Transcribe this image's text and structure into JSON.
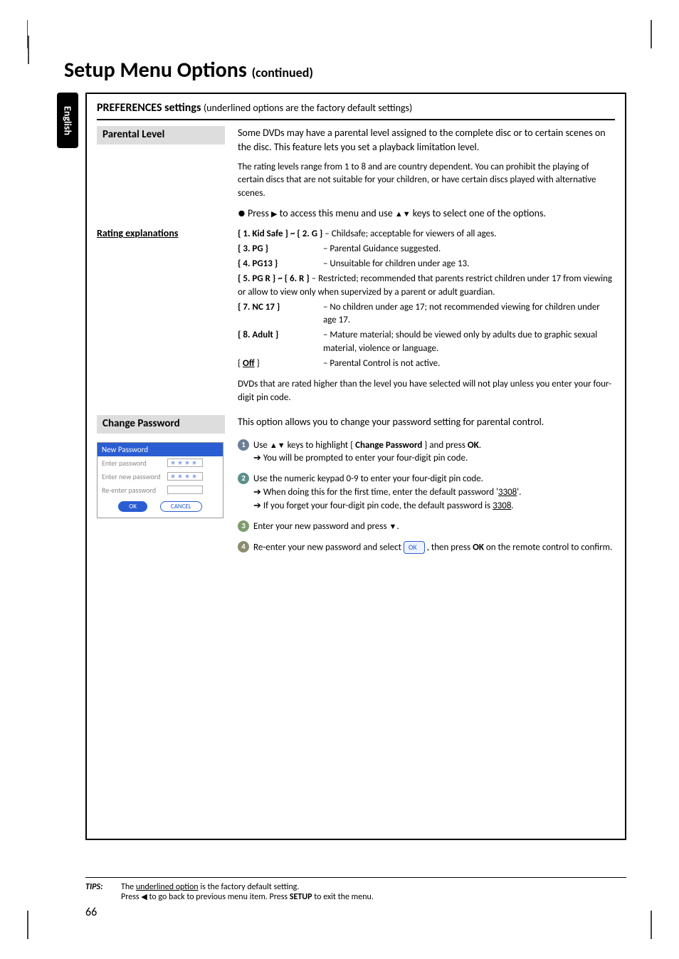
{
  "lang_tab": "English",
  "page_title_main": "Setup Menu Options ",
  "page_title_sub": "(continued)",
  "section_header_main": "PREFERENCES settings ",
  "section_header_sub": "(underlined options are the factory default settings)",
  "parental": {
    "label": "Parental Level",
    "intro": "Some DVDs may have a parental level assigned to the complete disc or to certain scenes on the disc. This feature lets you set a playback limitation level.",
    "note": "The rating levels range from 1 to 8 and are country dependent. You can prohibit the playing of certain discs that are not suitable for your children, or have certain discs played with alternative scenes.",
    "press_line_pre": "Press ",
    "press_line_mid": " to access this menu and use ",
    "press_line_post": " keys to select one of the options."
  },
  "ratings_heading": "Rating explanations",
  "ratings": [
    {
      "key": "{ 1. Kid Safe } ~ { 2. G }",
      "desc": "– Childsafe; acceptable for viewers of all ages."
    },
    {
      "key": "{ 3. PG }",
      "desc": "–  Parental Guidance suggested."
    },
    {
      "key": "{ 4. PG13 }",
      "desc": "–  Unsuitable for children under age 13."
    },
    {
      "key": "{ 5. PG R } ~ { 6. R }",
      "desc": "– Restricted; recommended that parents restrict children under 17 from viewing or allow to view only when supervized by a parent or adult guardian."
    },
    {
      "key": "{ 7. NC 17 }",
      "desc": "–  No children under age 17; not recommended viewing for children under age 17."
    },
    {
      "key": "{ 8. Adult }",
      "desc": "–  Mature material; should be viewed only by adults due to graphic sexual material, violence or language."
    }
  ],
  "off_key": "Off",
  "off_desc": "–  Parental Control is not active.",
  "ratings_footer": "DVDs that are rated higher than the level you have selected will not play unless you enter your four-digit pin code.",
  "change": {
    "label": "Change Password",
    "intro": "This option allows you to change your password setting for parental control."
  },
  "dialog": {
    "title": "New Password",
    "row1": "Enter password",
    "row2": "Enter new password",
    "row3": "Re-enter password",
    "stars": "＊＊＊＊",
    "ok": "OK",
    "cancel": "CANCEL"
  },
  "steps": {
    "s1a": "Use ",
    "s1b": " keys to highlight { ",
    "s1c": "Change Password",
    "s1d": " } and press ",
    "s1e": "OK",
    "s1f": ".",
    "s1sub": "You will be prompted to enter your four-digit pin code.",
    "s2a": "Use the numeric keypad 0-9 to enter your four-digit pin code.",
    "s2sub1": "When doing this for the first time, enter the default password '",
    "s2code": "3308",
    "s2sub1b": "'.",
    "s2sub2a": "If you forget your four-digit pin code, the default password is ",
    "s2sub2b": "3308",
    "s2sub2c": ".",
    "s3": "Enter your new password and press ",
    "s4a": "Re-enter your new password and select ",
    "s4ok": "OK",
    "s4b": " , then press ",
    "s4c": "OK",
    "s4d": " on the remote control to confirm."
  },
  "tips": {
    "label": "TIPS:",
    "line1a": "The ",
    "line1b": "underlined option",
    "line1c": " is the factory default setting.",
    "line2a": "Press ",
    "line2b": " to go back to previous menu item. Press ",
    "line2c": "SETUP",
    "line2d": " to exit the menu."
  },
  "page_number": "66"
}
